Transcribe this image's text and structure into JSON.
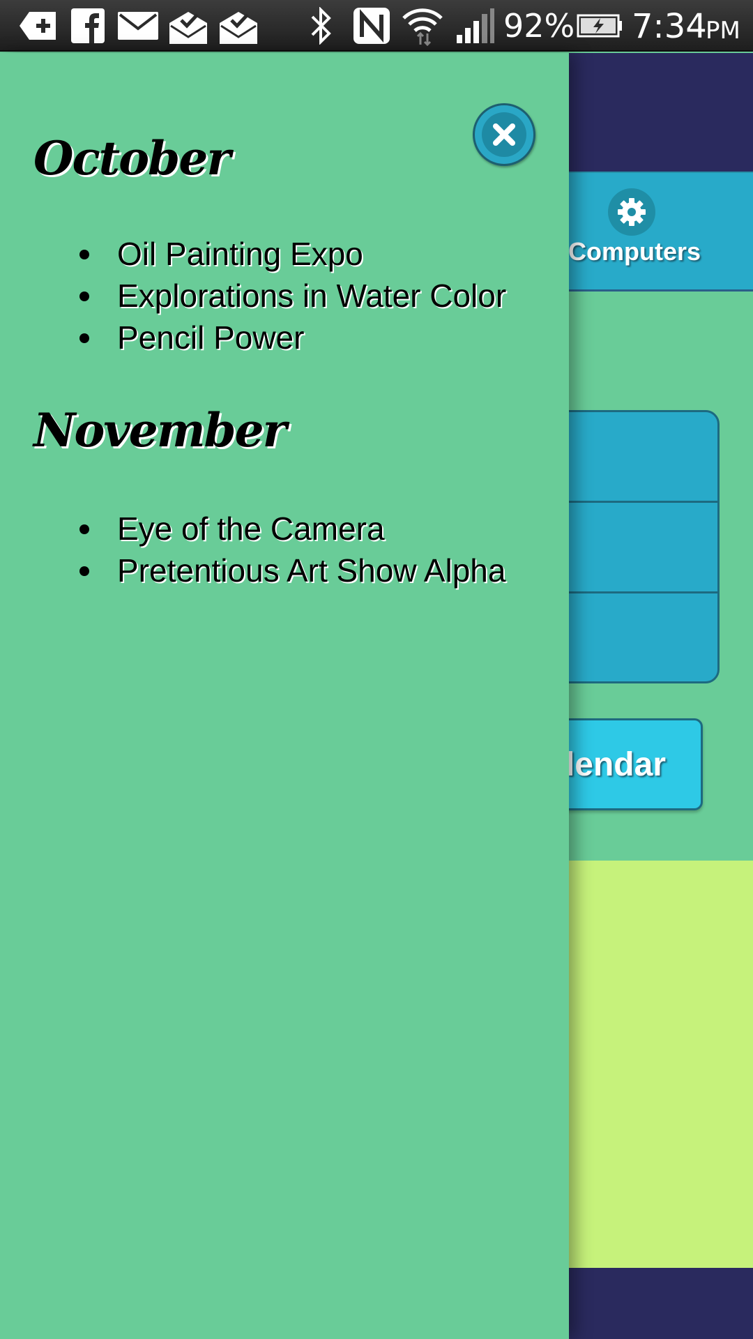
{
  "status_bar": {
    "icons": [
      "add-notification-icon",
      "facebook-icon",
      "mail-icon",
      "mail-open-check-icon",
      "mail-open-check-icon",
      "bluetooth-icon",
      "nfc-icon",
      "wifi-icon",
      "signal-icon",
      "battery-charging-icon"
    ],
    "battery": "92%",
    "time": "7:34",
    "ampm": "PM"
  },
  "background_app": {
    "category_label": "Computers",
    "calendar_button": "Calendar",
    "colors": {
      "header": "#2a2a5e",
      "tile": "#28aac9",
      "button": "#2ec9e6",
      "panel": "#c6f27b"
    }
  },
  "drawer": {
    "background": "#69cc98",
    "close_icon": "close-icon",
    "sections": [
      {
        "month": "October",
        "events": [
          "Oil Painting Expo",
          "Explorations in Water Color",
          "Pencil Power"
        ]
      },
      {
        "month": "November",
        "events": [
          "Eye of the Camera",
          "Pretentious Art Show Alpha"
        ]
      }
    ]
  }
}
